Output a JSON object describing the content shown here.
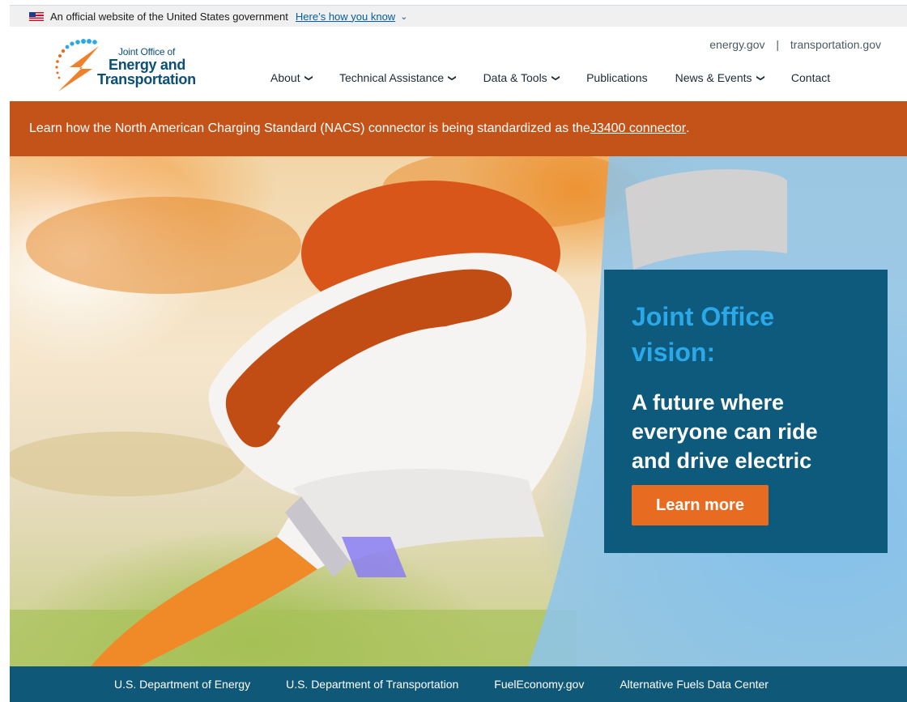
{
  "gov_banner": {
    "text": "An official website of the United States government",
    "link": "Here’s how you know"
  },
  "logo": {
    "line1": "Joint Office of",
    "line2": "Energy and",
    "line3": "Transportation"
  },
  "util_links": [
    "energy.gov",
    "transportation.gov"
  ],
  "nav": [
    {
      "label": "About",
      "dropdown": true
    },
    {
      "label": "Technical Assistance",
      "dropdown": true
    },
    {
      "label": "Data & Tools",
      "dropdown": true
    },
    {
      "label": "Publications",
      "dropdown": false
    },
    {
      "label": "News & Events",
      "dropdown": true
    },
    {
      "label": "Contact",
      "dropdown": false
    }
  ],
  "alert": {
    "text": "Learn how the North American Charging Standard (NACS) connector is being standardized as the ",
    "link": "J3400 connector",
    "suffix": "."
  },
  "hero": {
    "title": "Joint Office vision:",
    "body": "A future where everyone can ride and drive electric",
    "button": "Learn more"
  },
  "footer": [
    "U.S. Department of Energy",
    "U.S. Department of Transportation",
    "FuelEconomy.gov",
    "Alternative Fuels Data Center"
  ],
  "colors": {
    "brand_navy": "#0b4f77",
    "alert_orange": "#c4531a",
    "vision_panel": "#0d5a7d",
    "vision_title": "#2aa8e8",
    "button_orange": "#e86b22",
    "footer_blue": "#0f5878",
    "link_blue": "#005ea2"
  }
}
